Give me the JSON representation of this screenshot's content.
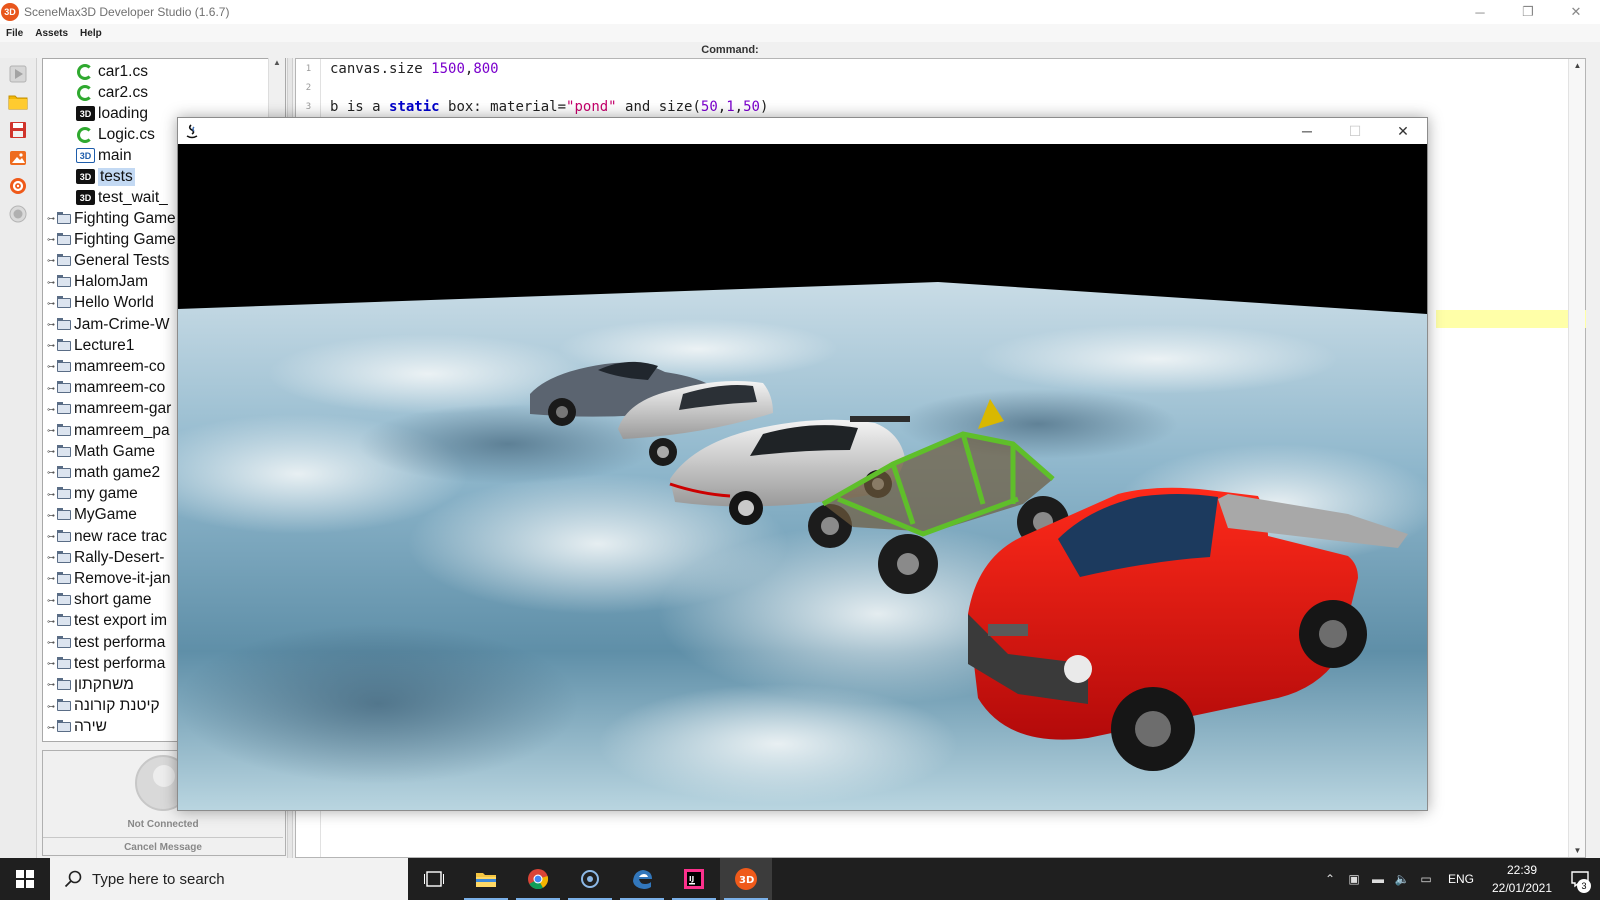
{
  "window": {
    "title": "SceneMax3D Developer Studio (1.6.7)",
    "icon_label": "3D",
    "minimize_glyph": "─",
    "restore_glyph": "❐",
    "close_glyph": "✕"
  },
  "menu": {
    "file": "File",
    "assets": "Assets",
    "help": "Help"
  },
  "toolbar": {
    "icons": [
      "play-icon",
      "open-folder-icon",
      "save-icon",
      "image-icon",
      "settings-icon",
      "record-icon"
    ]
  },
  "tree": {
    "files": [
      {
        "label": "car1.cs",
        "icon": "cs"
      },
      {
        "label": "car2.cs",
        "icon": "cs"
      },
      {
        "label": "loading",
        "icon": "sm"
      },
      {
        "label": "Logic.cs",
        "icon": "cs"
      },
      {
        "label": "main",
        "icon": "sm-blue"
      },
      {
        "label": "tests",
        "icon": "sm"
      },
      {
        "label": "test_wait_",
        "icon": "sm"
      }
    ],
    "folders": [
      "Fighting Game",
      "Fighting Game",
      "General Tests",
      "HalomJam",
      "Hello World",
      "Jam-Crime-W",
      "Lecture1",
      "mamreem-co",
      "mamreem-co",
      "mamreem-gar",
      "mamreem_pa",
      "Math Game",
      "math game2",
      "my game",
      "MyGame",
      "new race trac",
      "Rally-Desert-",
      "Remove-it-jan",
      "short game",
      "test export im",
      "test performa",
      "test performa",
      "משחקתון",
      "קיטנת קורונה",
      "שירה"
    ],
    "selected": "tests"
  },
  "status": {
    "connection": "Not Connected",
    "cancel": "Cancel Message"
  },
  "command_label": "Command:",
  "editor": {
    "line_numbers": [
      "1",
      "2",
      "3"
    ],
    "line1": {
      "text": "canvas.size ",
      "n1": "1500",
      "comma": ",",
      "n2": "800"
    },
    "line3": {
      "a": "b is a ",
      "kw": "static",
      "b": " box: material=",
      "str": "\"pond\"",
      "c": " and size(",
      "n1": "50",
      "c1": ",",
      "n2": "1",
      "c2": ",",
      "n3": "50",
      "d": ")"
    }
  },
  "game_window": {
    "minimize_glyph": "─",
    "maximize_glyph": "☐",
    "close_glyph": "✕",
    "scene_objects": [
      "sports-car-dark",
      "hatchback-silver",
      "gtr-silver",
      "buggy-green",
      "pickup-red"
    ]
  },
  "taskbar": {
    "search_placeholder": "Type here to search",
    "apps": [
      "task-view-icon",
      "file-explorer-icon",
      "chrome-icon",
      "cortana-icon",
      "edge-icon",
      "intellij-icon",
      "scenemax-icon"
    ],
    "scenemax_label": "3D",
    "intellij_label": "IJ",
    "language": "ENG",
    "time": "22:39",
    "date": "22/01/2021",
    "notification_count": "3",
    "tray_glyphs": [
      "⌃",
      "▣",
      "▬",
      "🔈",
      "▭"
    ]
  },
  "colors": {
    "keyword": "#0000cc",
    "number": "#7a00cc",
    "string": "#c5006b",
    "highlight_line": "#ffffa8",
    "pickup": "#e01010",
    "buggy": "#5fbf2a"
  }
}
